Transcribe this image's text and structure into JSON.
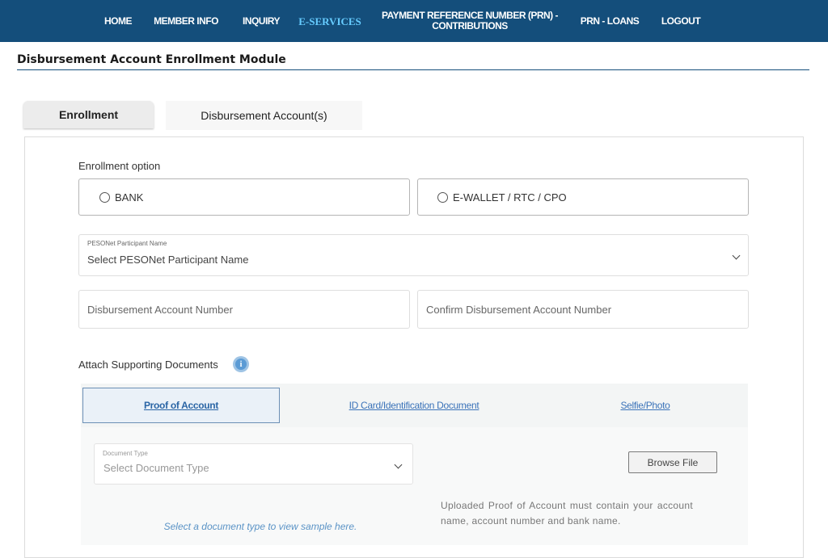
{
  "nav": {
    "home": "HOME",
    "member_info": "MEMBER INFO",
    "inquiry": "INQUIRY",
    "eservices": "E-SERVICES",
    "prn_contrib": "PAYMENT REFERENCE NUMBER (PRN) - CONTRIBUTIONS",
    "prn_loans": "PRN - LOANS",
    "logout": "LOGOUT"
  },
  "page_title": "Disbursement Account Enrollment Module",
  "tabs": {
    "enrollment": "Enrollment",
    "accounts": "Disbursement Account(s)"
  },
  "form": {
    "enrollment_option_label": "Enrollment option",
    "option_bank": "BANK",
    "option_ewallet": "E-WALLET / RTC / CPO",
    "pesonet_label": "PESONet Participant Name",
    "pesonet_value": "Select PESONet Participant Name",
    "account_number_placeholder": "Disbursement Account Number",
    "confirm_account_placeholder": "Confirm Disbursement Account Number",
    "attach_label": "Attach Supporting Documents",
    "info_glyph": "i"
  },
  "doc_tabs": {
    "proof": "Proof of Account",
    "id_card": "ID Card/Identification Document",
    "selfie": "Selfie/Photo"
  },
  "upload": {
    "doc_type_label": "Document Type",
    "doc_type_value": "Select Document Type",
    "browse_label": "Browse File",
    "note": "Uploaded Proof of Account must contain your account name, account number and bank name.",
    "sample_hint": "Select a document type to view sample here."
  },
  "colors": {
    "nav_bg": "#144e7b",
    "nav_active": "#66ccff",
    "link": "#3b73b9"
  }
}
